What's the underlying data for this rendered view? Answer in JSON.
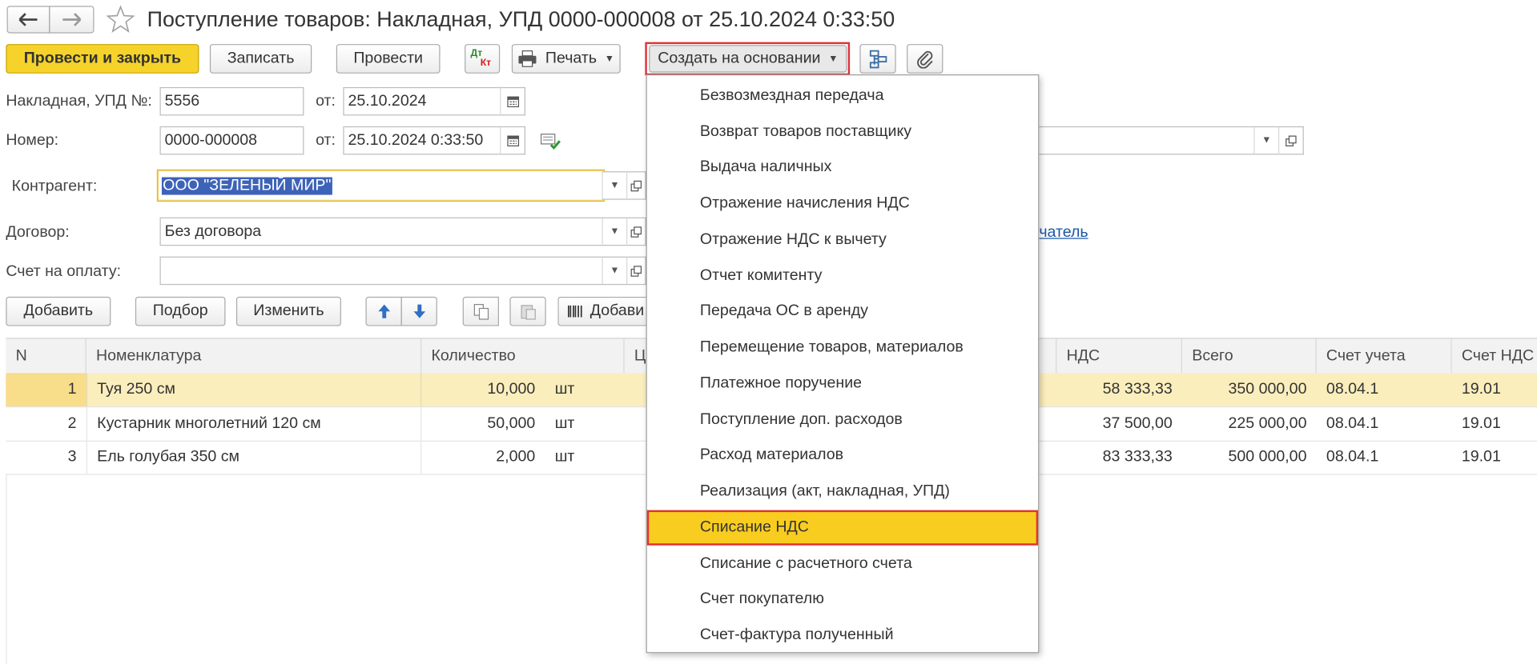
{
  "window": {
    "title": "Поступление товаров: Накладная, УПД 0000-000008 от 25.10.2024 0:33:50"
  },
  "toolbar": {
    "post_close": "Провести и закрыть",
    "save": "Записать",
    "post": "Провести",
    "dtkt_top": "Дт",
    "dtkt_bottom": "Кт",
    "print": "Печать",
    "create_based": "Создать на основании"
  },
  "form": {
    "invoice_label": "Накладная, УПД №:",
    "invoice_value": "5556",
    "from_label_1": "от:",
    "invoice_date": "25.10.2024",
    "number_label": "Номер:",
    "number_value": "0000-000008",
    "from_label_2": "от:",
    "number_date": "25.10.2024  0:33:50",
    "counterparty_label": "Контрагент:",
    "counterparty_value": "ООО \"ЗЕЛЕНЫЙ МИР\"",
    "contract_label": "Договор:",
    "contract_value": "Без договора",
    "invoice_pay_label": "Счет на оплату:",
    "invoice_pay_value": "",
    "link_fragment": "чатель"
  },
  "table_toolbar": {
    "add": "Добавить",
    "pick": "Подбор",
    "change": "Изменить",
    "add_barcode": "Добави"
  },
  "table": {
    "columns": [
      "N",
      "Номенклатура",
      "Количество",
      "Ц",
      "НДС",
      "Всего",
      "Счет учета",
      "Счет НДС"
    ],
    "rows": [
      {
        "n": "1",
        "name": "Туя 250 см",
        "qty": "10,000",
        "unit": "шт",
        "vat": "58 333,33",
        "total": "350 000,00",
        "account": "08.04.1",
        "vat_account": "19.01"
      },
      {
        "n": "2",
        "name": "Кустарник многолетний 120 см",
        "qty": "50,000",
        "unit": "шт",
        "vat": "37 500,00",
        "total": "225 000,00",
        "account": "08.04.1",
        "vat_account": "19.01"
      },
      {
        "n": "3",
        "name": "Ель голубая 350 см",
        "qty": "2,000",
        "unit": "шт",
        "vat": "83 333,33",
        "total": "500 000,00",
        "account": "08.04.1",
        "vat_account": "19.01"
      }
    ]
  },
  "menu": {
    "items": [
      "Безвозмездная передача",
      "Возврат товаров поставщику",
      "Выдача наличных",
      "Отражение начисления НДС",
      "Отражение НДС к вычету",
      "Отчет комитенту",
      "Передача ОС в аренду",
      "Перемещение товаров, материалов",
      "Платежное поручение",
      "Поступление доп. расходов",
      "Расход материалов",
      "Реализация (акт, накладная, УПД)",
      "Списание НДС",
      "Списание с расчетного счета",
      "Счет покупателю",
      "Счет-фактура полученный"
    ],
    "highlighted": "Списание НДС"
  },
  "colors": {
    "primary_button": "#f5d32a",
    "highlight": "#f9cd1f",
    "highlight_border": "#e0323a",
    "selected_row": "#fbeebd",
    "link": "#1a56a8"
  }
}
